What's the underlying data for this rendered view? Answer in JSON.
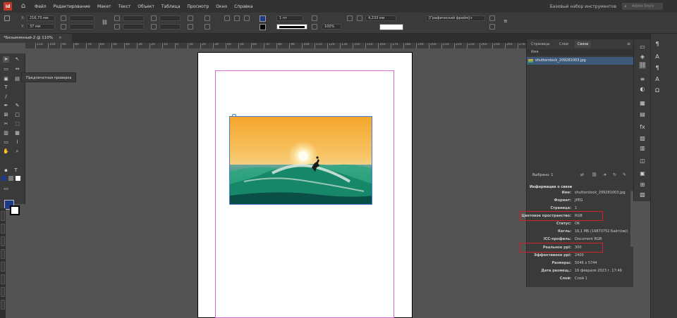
{
  "menubar": {
    "app_icon": "Id",
    "items": [
      "Файл",
      "Редактирование",
      "Макет",
      "Текст",
      "Объект",
      "Таблица",
      "Просмотр",
      "Окно",
      "Справка"
    ],
    "workspace": "Базовый набор инструментов",
    "search_placeholder": "Adobe Stock"
  },
  "control": {
    "x_label": "X:",
    "x_value": "216,75 мм",
    "y_label": "Y:",
    "y_value": "37 мм",
    "stroke_weight": "1 пт",
    "opacity": "100%",
    "dimension": "4,233 мм",
    "style_value": "[Графический фрейм]+",
    "percent": "100%",
    "accent_fill": "#1e3a8a"
  },
  "document": {
    "tab_label": "*Безымянный-2 @ 110%"
  },
  "ruler": {
    "ticks": [
      "110",
      "100",
      "90",
      "80",
      "70",
      "60",
      "50",
      "40",
      "30",
      "20",
      "10",
      "0",
      "10",
      "20",
      "30",
      "40",
      "50",
      "60",
      "70",
      "80",
      "90",
      "100",
      "110",
      "120",
      "130",
      "140",
      "150",
      "160",
      "170",
      "180",
      "190",
      "200",
      "210",
      "220",
      "230",
      "240",
      "250",
      "260",
      "270"
    ]
  },
  "preflight": {
    "label": "Предпечатная проверка"
  },
  "panel": {
    "tabs": [
      "Страницы",
      "Слои",
      "Связи"
    ],
    "name_col": "Имя",
    "link_file": "shutterstock_209281003.jpg",
    "selected": "Выбрано: 1",
    "info_title": "Информация о связи",
    "info": [
      {
        "key": "Имя:",
        "value": "shutterstock_209281003.jpg"
      },
      {
        "key": "Формат:",
        "value": "JPEG"
      },
      {
        "key": "Страница:",
        "value": "1"
      },
      {
        "key": "Цветовое пространство:",
        "value": "RGB"
      },
      {
        "key": "Статус:",
        "value": "OK"
      },
      {
        "key": "Кегль:",
        "value": "16,1 МБ (16870752 Байт(ов))"
      },
      {
        "key": "ICC-профиль:",
        "value": "Document RGB"
      },
      {
        "key": "Реальное ppi:",
        "value": "300"
      },
      {
        "key": "Эффективное ppi:",
        "value": "2400"
      },
      {
        "key": "Размеры:",
        "value": "5046 x 5744"
      },
      {
        "key": "Дата размещ.:",
        "value": "16 февраля 2023 г. 17:49"
      },
      {
        "key": "Слой:",
        "value": "Слой 1"
      }
    ]
  },
  "colors": {
    "accent_blue": "#1e3a8a",
    "highlight_red": "#d0202a",
    "margin_guide": "#d16ad1",
    "frame_edge": "#4a7fd0"
  }
}
